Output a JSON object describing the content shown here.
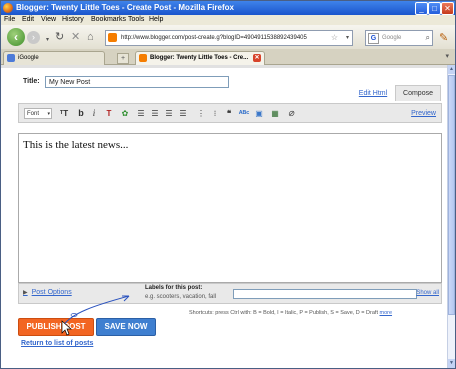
{
  "window": {
    "title": "Blogger: Twenty Little Toes - Create Post - Mozilla Firefox"
  },
  "menu": [
    "File",
    "Edit",
    "View",
    "History",
    "Bookmarks",
    "Tools",
    "Help"
  ],
  "nav": {
    "url": "http://www.blogger.com/post-create.g?blogID=4904911538892439405",
    "search_placeholder": "Google"
  },
  "tabs": [
    {
      "label": "iGoogle"
    },
    {
      "label": "Blogger: Twenty Little Toes - Cre..."
    }
  ],
  "post": {
    "title_label": "Title:",
    "title_value": "My New Post",
    "edit_html": "Edit Html",
    "compose": "Compose",
    "font_select": "Font",
    "preview": "Preview",
    "body_text": "This is the latest news...",
    "post_options": "Post Options",
    "labels_label": "Labels for this post:",
    "labels_example": "e.g. scooters, vacation, fall",
    "show_all": "Show all",
    "shortcuts": "Shortcuts: press Ctrl with: B = Bold, I = Italic, P = Publish, S = Save, D = Draft",
    "shortcuts_more": "more",
    "publish": "PUBLISH POST",
    "save": "SAVE NOW",
    "return": "Return to list of posts"
  },
  "icons": {
    "toolbar": [
      "font-size-icon",
      "bold-icon",
      "italic-icon",
      "text-color-icon",
      "highlight-icon",
      "align-left-icon",
      "align-center-icon",
      "align-right-icon",
      "justify-icon",
      "numbered-list-icon",
      "bulleted-list-icon",
      "blockquote-icon",
      "spellcheck-icon",
      "insert-image-icon",
      "insert-video-icon",
      "remove-formatting-icon"
    ]
  }
}
